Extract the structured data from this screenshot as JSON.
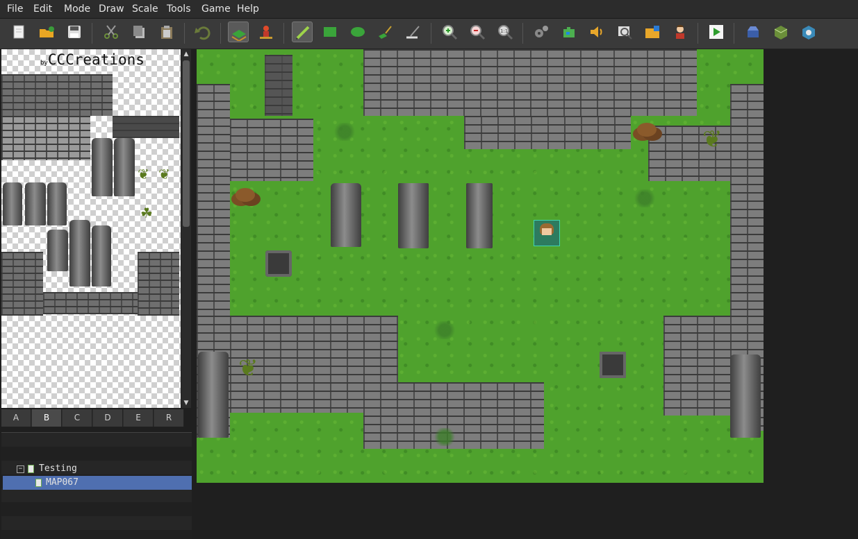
{
  "menu": [
    "File",
    "Edit",
    "Mode",
    "Draw",
    "Scale",
    "Tools",
    "Game",
    "Help"
  ],
  "toolbar": {
    "groups": [
      [
        "new-project-icon",
        "open-project-icon",
        "save-project-icon"
      ],
      [
        "cut-icon",
        "copy-icon",
        "paste-icon"
      ],
      [
        "undo-icon"
      ],
      [
        "map-layer-icon",
        "event-layer-icon"
      ],
      [
        "pencil-icon",
        "rectangle-icon",
        "ellipse-icon",
        "fill-icon",
        "shadow-pen-icon"
      ],
      [
        "zoom-in-icon",
        "zoom-out-icon",
        "zoom-actual-icon"
      ],
      [
        "database-icon",
        "plugin-manager-icon",
        "sound-test-icon",
        "event-searcher-icon",
        "resource-manager-icon",
        "character-generator-icon"
      ],
      [
        "playtest-icon"
      ],
      [
        "deploy-icon",
        "package-icon",
        "steam-icon"
      ]
    ],
    "active": [
      "map-layer-icon",
      "pencil-icon"
    ]
  },
  "palette": {
    "title": "CCCreations",
    "by": "by"
  },
  "tabs": [
    "A",
    "B",
    "C",
    "D",
    "E",
    "R"
  ],
  "active_tab": "B",
  "tree": {
    "project": "Testing",
    "map": "MAP067"
  },
  "colors": {
    "grass": "#4fa22d",
    "stone": "#7d7d7d",
    "selection": "#4f6fb0",
    "hero_frame": "#3fd6b3"
  }
}
